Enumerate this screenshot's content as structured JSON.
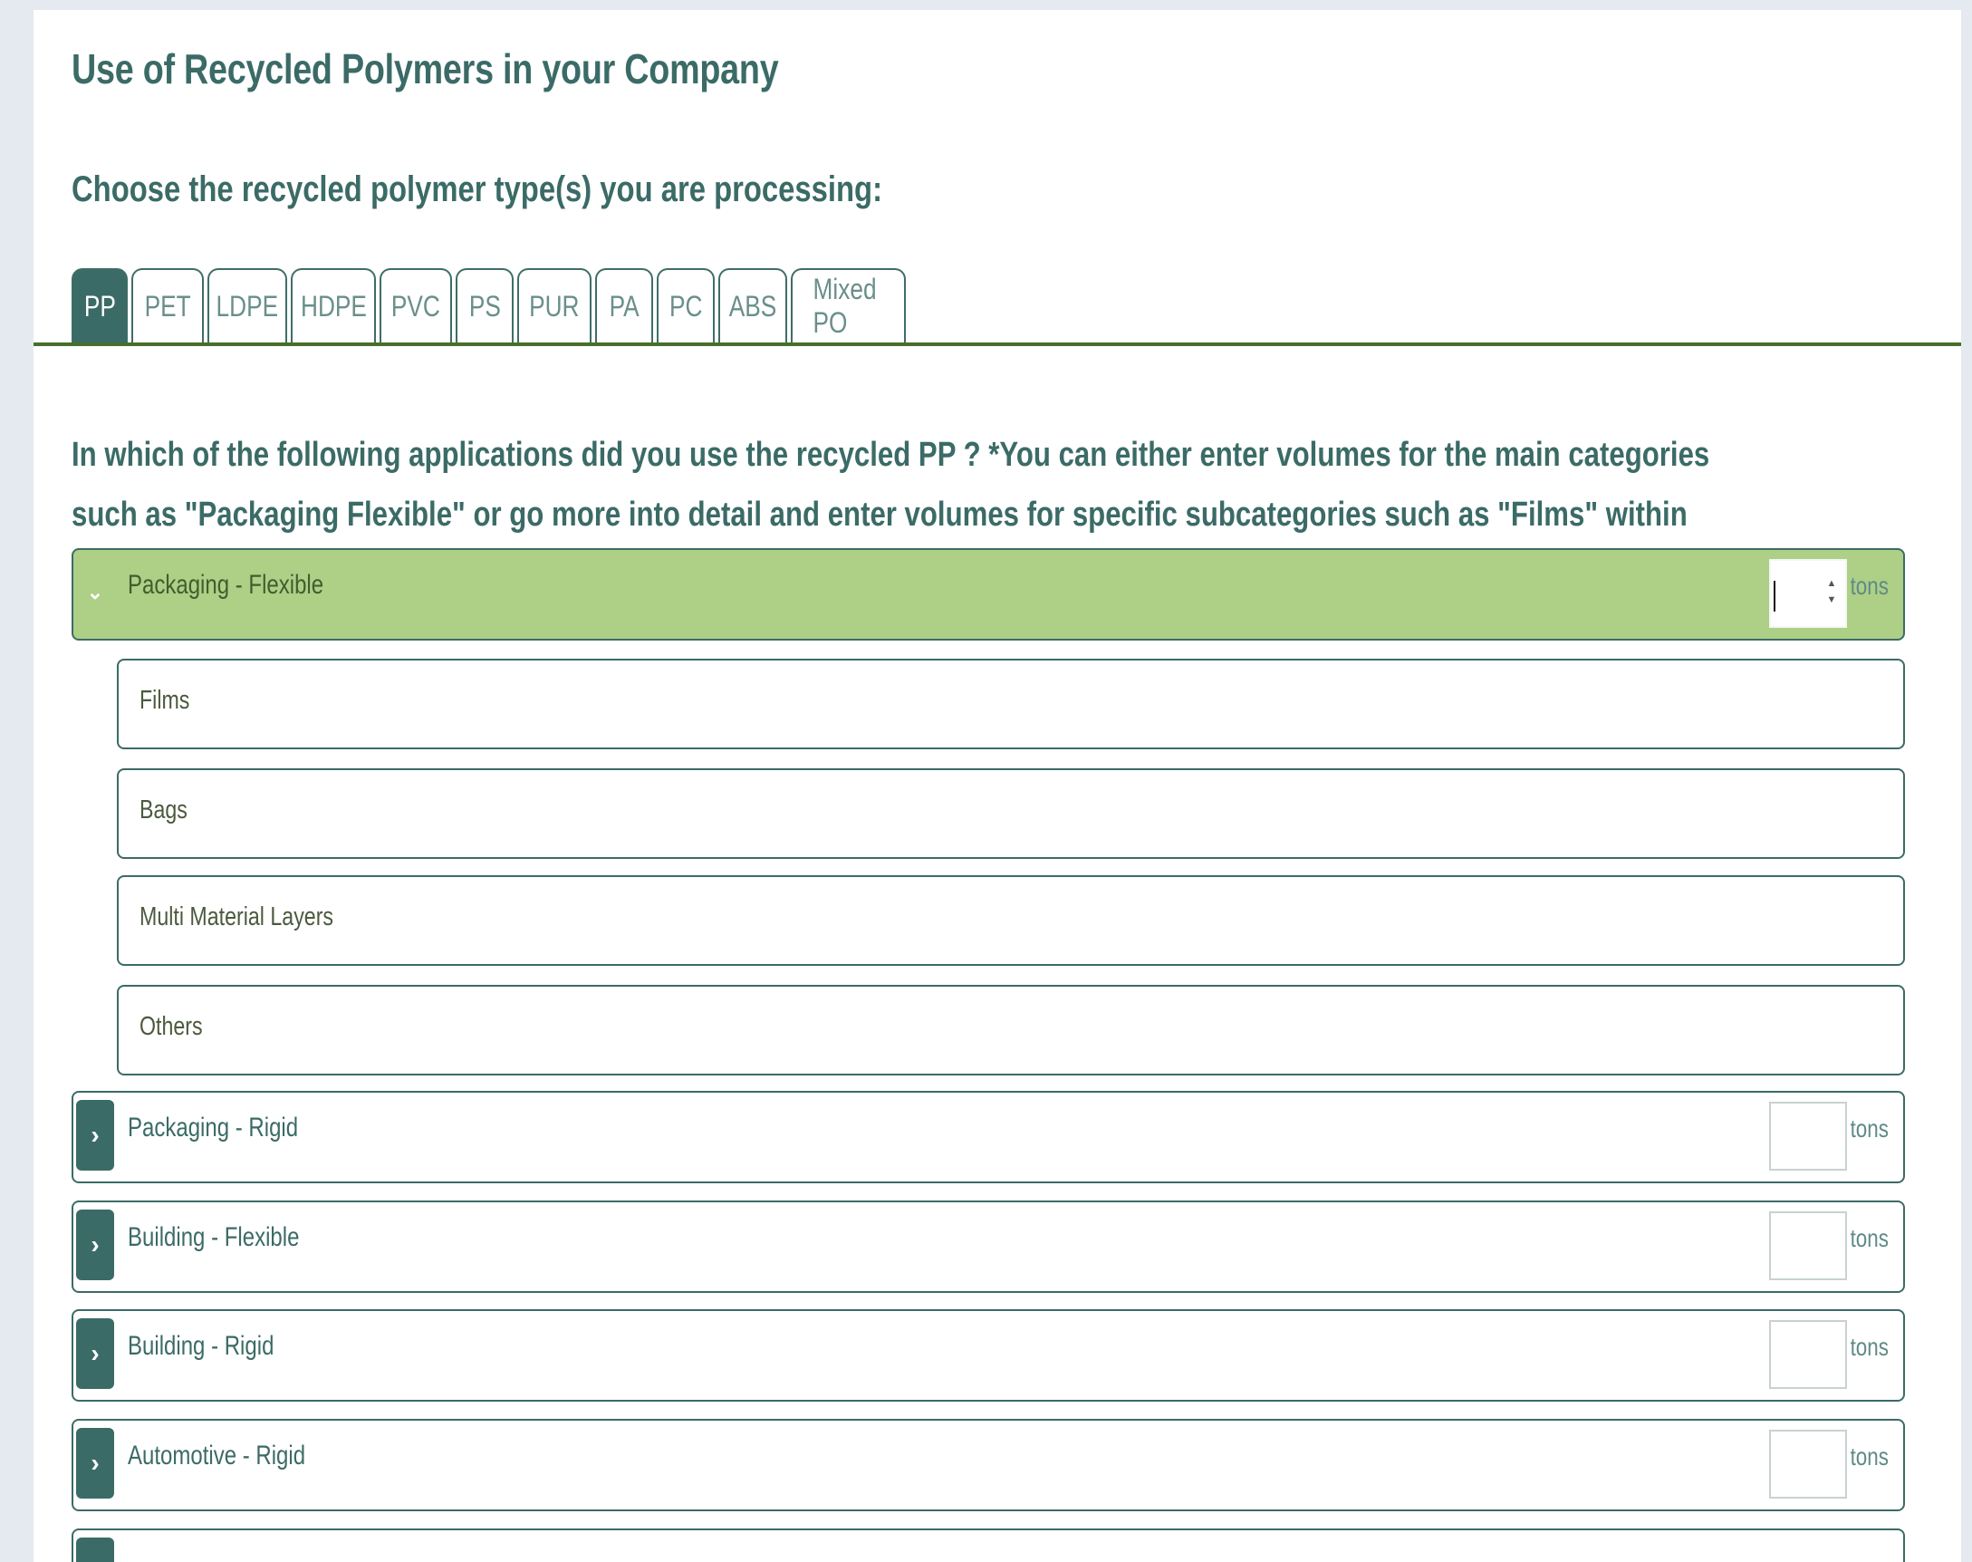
{
  "page": {
    "title": "Use of Recycled Polymers in your Company",
    "subtitle": "Choose the recycled polymer type(s) you are processing:",
    "question": "In which of the following applications did you use the recycled PP ? *You can either enter volumes for the main categories such as \"Packaging Flexible\" or go more into detail and enter volumes for specific subcategories such as \"Films\" within \"Packaging - Flexible\""
  },
  "tabs": [
    {
      "label": "PP",
      "active": true
    },
    {
      "label": "PET",
      "active": false
    },
    {
      "label": "LDPE",
      "active": false
    },
    {
      "label": "HDPE",
      "active": false
    },
    {
      "label": "PVC",
      "active": false
    },
    {
      "label": "PS",
      "active": false
    },
    {
      "label": "PUR",
      "active": false
    },
    {
      "label": "PA",
      "active": false
    },
    {
      "label": "PC",
      "active": false
    },
    {
      "label": "ABS",
      "active": false
    },
    {
      "label": "Mixed PO",
      "active": false
    }
  ],
  "unit_label": "tons",
  "expanded_category": {
    "label": "Packaging - Flexible",
    "value": "",
    "subcategories": [
      "Films",
      "Bags",
      "Multi Material Layers",
      "Others"
    ]
  },
  "collapsed_categories": [
    {
      "label": "Packaging - Rigid",
      "value": ""
    },
    {
      "label": "Building - Flexible",
      "value": ""
    },
    {
      "label": "Building - Rigid",
      "value": ""
    },
    {
      "label": "Automotive - Rigid",
      "value": ""
    }
  ],
  "colors": {
    "accent": "#3b6b66",
    "expanded_row": "#adcf86",
    "tab_rule": "#476e2b",
    "background": "#e5eaf1"
  }
}
